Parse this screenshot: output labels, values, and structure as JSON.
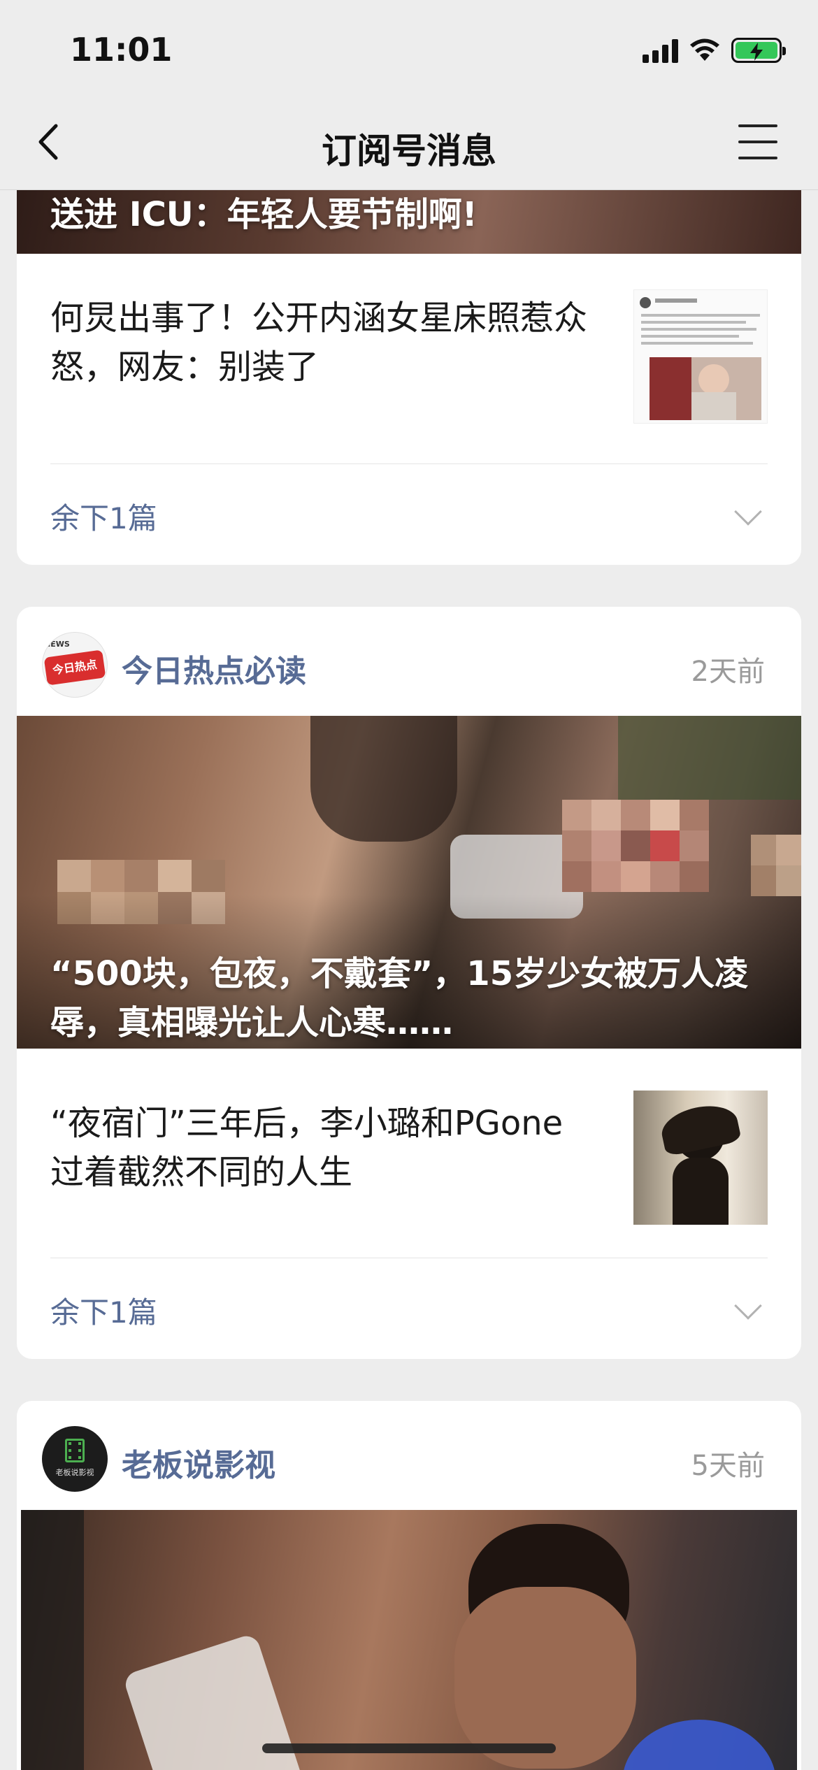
{
  "status_bar": {
    "time": "11:01"
  },
  "nav": {
    "title": "订阅号消息"
  },
  "cards": [
    {
      "cover_title": "送进 ICU：年轻人要节制啊!",
      "sub_article": "何炅出事了！公开内涵女星床照惹众怒，网友：别装了",
      "more_label": "余下1篇"
    },
    {
      "account": "今日热点必读",
      "avatar_text": "今日热点",
      "avatar_badge": "NEWS",
      "time": "2天前",
      "cover_title": "“500块，包夜，不戴套”，15岁少女被万人凌辱，真相曝光让人心寒……",
      "sub_article": "“夜宿门”三年后，李小璐和PGone过着截然不同的人生",
      "more_label": "余下1篇"
    },
    {
      "account": "老板说影视",
      "avatar_text": "老板说影视",
      "time": "5天前"
    }
  ]
}
